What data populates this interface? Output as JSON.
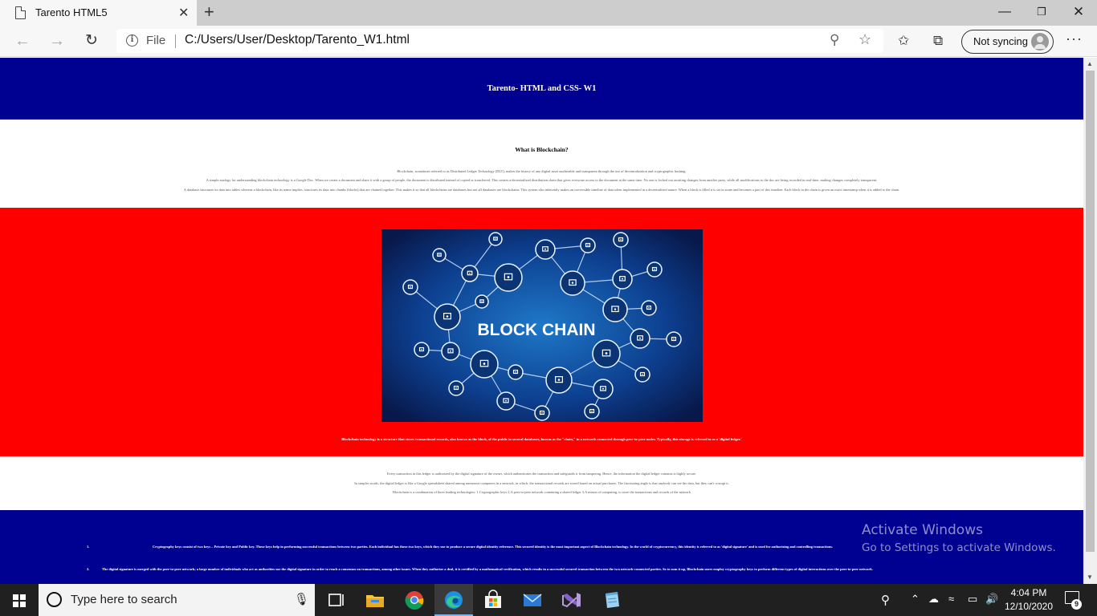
{
  "browser": {
    "tab_title": "Tarento HTML5",
    "tab_close": "✕",
    "new_tab": "+",
    "scheme_label": "File",
    "url": "C:/Users/User/Desktop/Tarento_W1.html",
    "sync_label": "Not syncing"
  },
  "page": {
    "header_title": "Tarento- HTML and CSS- W1",
    "intro": {
      "heading": "What is Blockchain?",
      "p1": "Blockchain, sometimes referred to as Distributed Ledger Technology (DLT), makes the history of any digital asset unalterable and transparent through the use of decentralization and cryptographic hashing.",
      "p2": "A simple analogy for understanding blockchain technology is a Google Doc. When we create a document and share it with a group of people, the document is distributed instead of copied or transferred. This creates a decentralized distribution chain that gives everyone access to the document at the same time. No one is locked out awaiting changes from another party, while all modifications to the doc are being recorded in real-time, making changes completely transparent.",
      "p3": "A database structures its data into tables whereas a blockchain, like its name implies, structures its data into chunks (blocks) that are chained together. This makes it so that all blockchains are databases but not all databases are blockchains. This system also inherently makes an irreversible timeline of data when implemented in a decentralized nature. When a block is filled it is set in stone and becomes a part of this timeline. Each block in the chain is given an exact timestamp when it is added to the chain."
    },
    "image": {
      "caption_text": "BLOCK CHAIN"
    },
    "red_caption": "Blockchain technology is a structure that stores transactional records, also known as the block, of the public in several databases, known as the \"chain,\" in a network connected through peer-to-peer nodes. Typically, this storage is referred to as a 'digital ledger.'",
    "section2": {
      "p1": "Every transaction in this ledger is authorized by the digital signature of the owner, which authenticates the transaction and safeguards it from tampering. Hence, the information the digital ledger contains is highly secure.",
      "p2": "In simpler words, the digital ledger is like a Google spreadsheet shared among numerous computers in a network, in which, the transactional records are stored based on actual purchases. The fascinating angle is that anybody can see the data, but they can't corrupt it.",
      "p3": "Blockchain is a combination of three leading technologies: 1.Cryptographic keys 2.A peer-to-peer network containing a shared ledger 3.A means of computing, to store the transactions and records of the network"
    },
    "list": [
      {
        "num": "1.",
        "text": "Cryptography keys consist of two keys – Private key and Public key. These keys help in performing successful transactions between two parties. Each individual has these two keys, which they use to produce a secure digital identity reference. This secured identity is the most important aspect of Blockchain technology. In the world of cryptocurrency, this identity is referred to as 'digital signature' and is used for authorizing and controlling transactions."
      },
      {
        "num": "2.",
        "text": "The digital signature is merged with the peer-to-peer network; a large number of individuals who act as authorities use the digital signature in order to reach a consensus on transactions, among other issues. When they authorize a deal, it is certified by a mathematical verification, which results in a successful secured transaction between the two network-connected parties. So to sum it up, Blockchain users employ cryptography keys to perform different types of digital interactions over the peer-to-peer network."
      }
    ]
  },
  "watermark": {
    "line1": "Activate Windows",
    "line2": "Go to Settings to activate Windows."
  },
  "taskbar": {
    "search_placeholder": "Type here to search",
    "time": "4:04 PM",
    "date": "12/10/2020",
    "notification_count": "9"
  },
  "colors": {
    "header_blue": "#010191",
    "section_red": "#fe0000"
  }
}
